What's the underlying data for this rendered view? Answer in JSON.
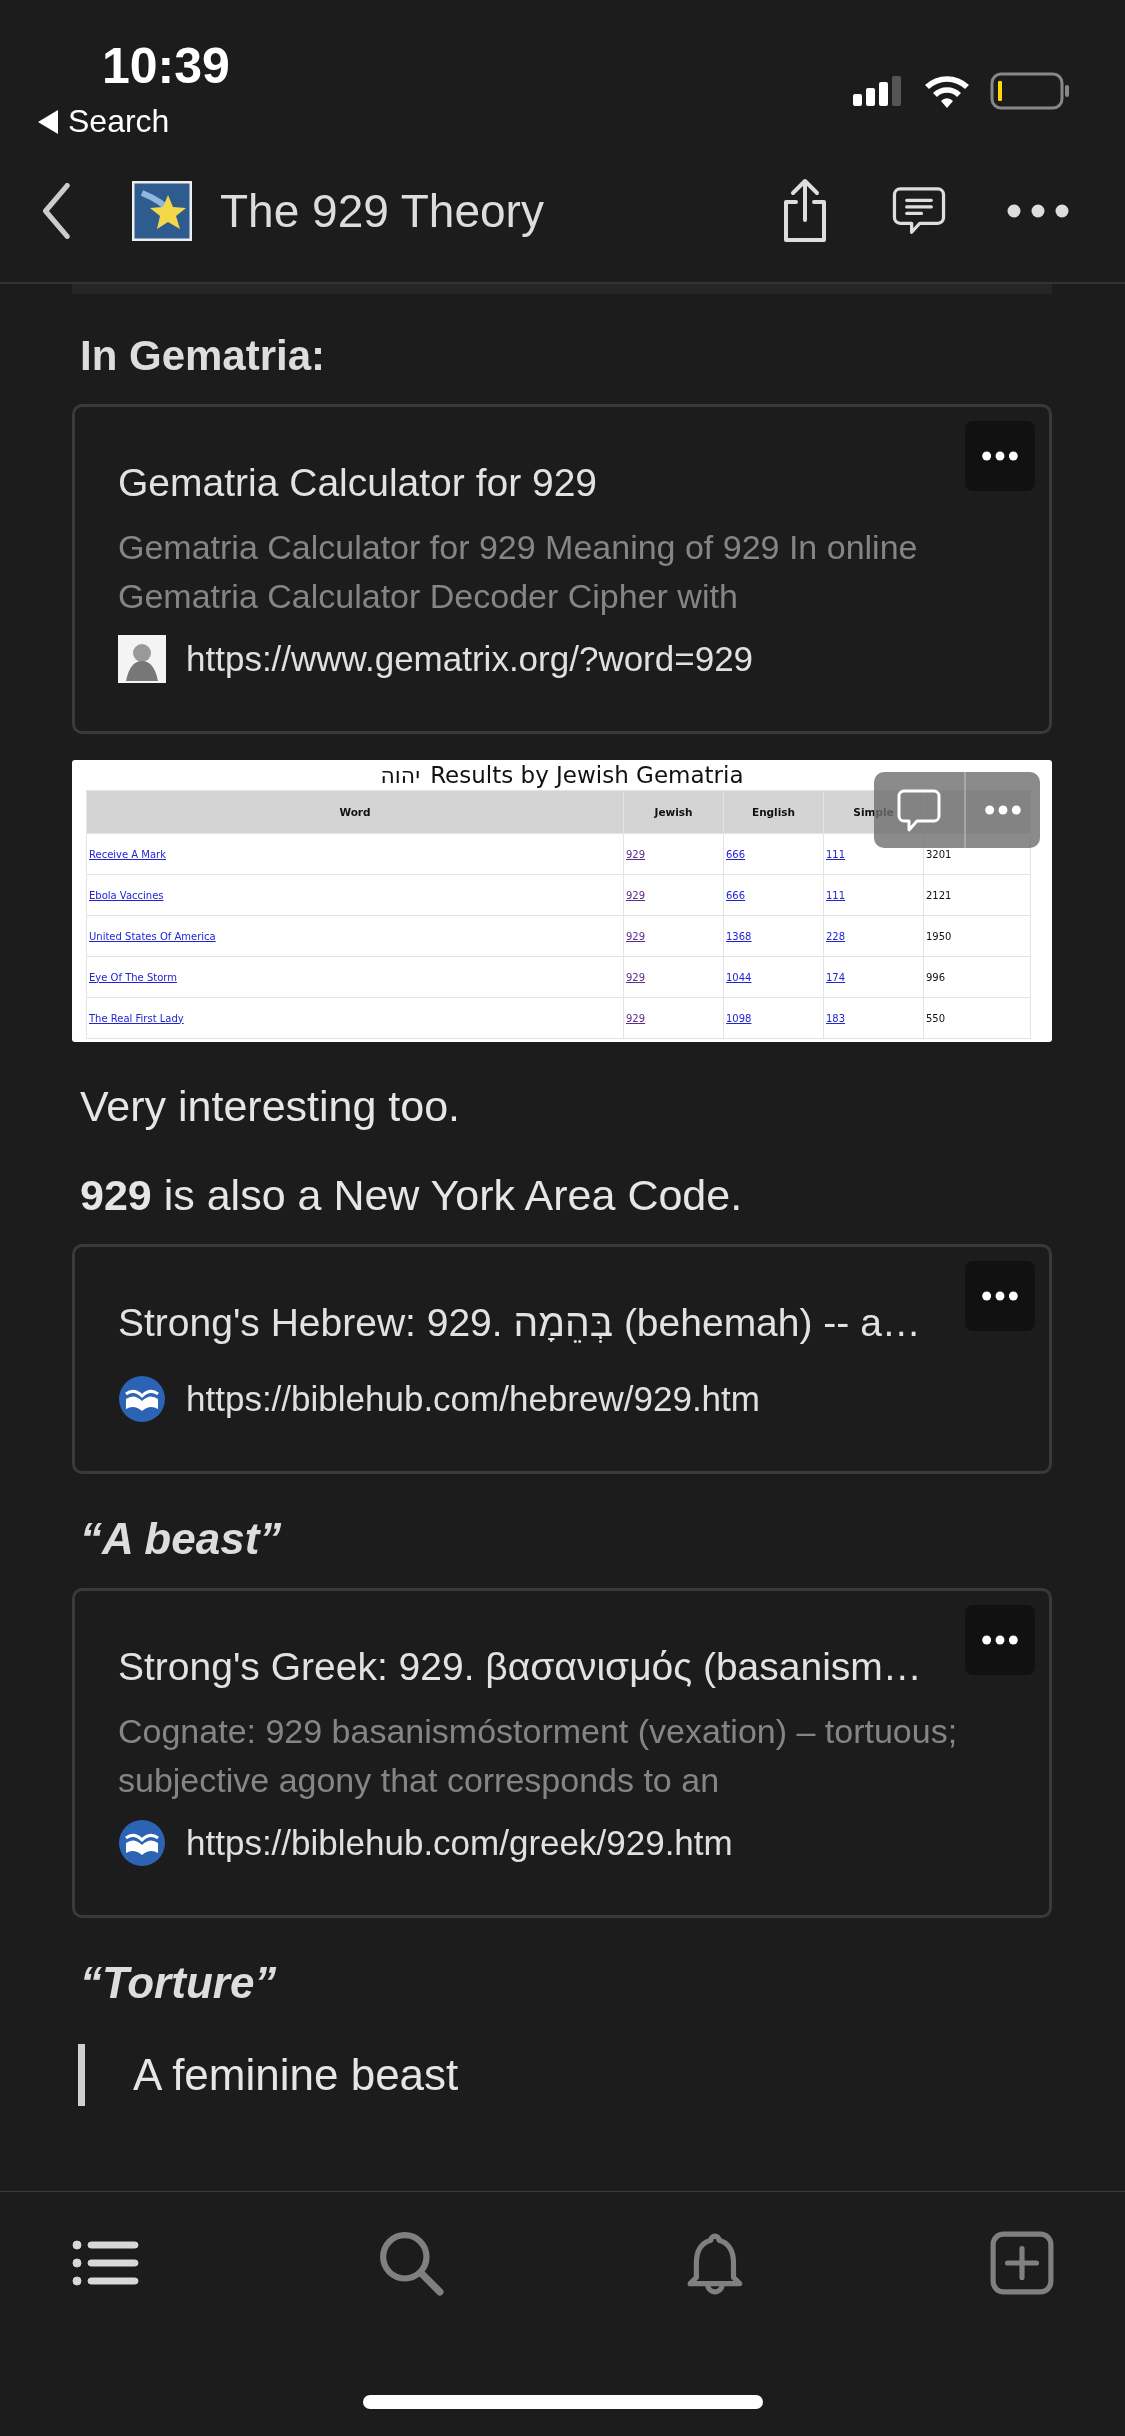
{
  "status_bar": {
    "time": "10:39",
    "back_label": "Search"
  },
  "nav": {
    "title": "The 929 Theory"
  },
  "blocks": [
    {
      "kind": "heading",
      "text": "In Gematria:"
    },
    {
      "kind": "bookmark",
      "title": "Gematria Calculator for 929",
      "description": "Gematria Calculator for 929 Meaning of 929 In online Gematria Calculator Decoder Cipher with",
      "url": "https://www.gematrix.org/?word=929",
      "favicon": {
        "kind": "portrait"
      }
    },
    {
      "kind": "image",
      "title_mark": "יהוה",
      "title": "Results by Jewish Gematria",
      "columns": [
        "Word",
        "Jewish",
        "English",
        "Simple"
      ],
      "rows": [
        [
          "Receive A Mark",
          "929",
          "666",
          "111",
          "3201"
        ],
        [
          "Ebola Vaccines",
          "929",
          "666",
          "111",
          "2121"
        ],
        [
          "United States Of America",
          "929",
          "1368",
          "228",
          "1950"
        ],
        [
          "Eye Of The Storm",
          "929",
          "1044",
          "174",
          "996"
        ],
        [
          "The Real First Lady",
          "929",
          "1098",
          "183",
          "550"
        ]
      ]
    },
    {
      "kind": "paragraph",
      "text": "Very interesting too."
    },
    {
      "kind": "paragraph",
      "text": "**929** is also a New York Area Code."
    },
    {
      "kind": "bookmark",
      "title": "Strong's Hebrew: 929. בְּהֵמָה (behemah) -- a…",
      "url": "https://biblehub.com/hebrew/929.htm",
      "favicon": {
        "kind": "book"
      }
    },
    {
      "kind": "emphasis",
      "text": "“A beast”"
    },
    {
      "kind": "bookmark",
      "title": "Strong's Greek: 929. βασανισμός (basanism…",
      "description": "Cognate: 929 basanismóstorment (vexation) – tortuous; subjective agony that corresponds to an",
      "url": "https://biblehub.com/greek/929.htm",
      "favicon": {
        "kind": "book"
      }
    },
    {
      "kind": "emphasis",
      "text": "“Torture”"
    },
    {
      "kind": "quote",
      "text": "A feminine beast"
    }
  ],
  "tab_bar": [
    {
      "kind": "list",
      "selected": true
    },
    {
      "kind": "search",
      "selected": false
    },
    {
      "kind": "bell",
      "selected": false
    },
    {
      "kind": "add",
      "selected": false
    }
  ]
}
